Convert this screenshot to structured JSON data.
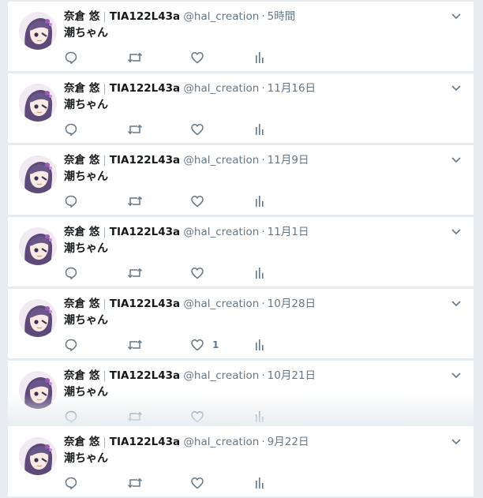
{
  "tweets": [
    {
      "name": "奈倉 悠",
      "display": "TIA122L43a",
      "handle": "@hal_creation",
      "time": "5時間",
      "text": "潮ちゃん",
      "likes": ""
    },
    {
      "name": "奈倉 悠",
      "display": "TIA122L43a",
      "handle": "@hal_creation",
      "time": "11月16日",
      "text": "潮ちゃん",
      "likes": ""
    },
    {
      "name": "奈倉 悠",
      "display": "TIA122L43a",
      "handle": "@hal_creation",
      "time": "11月9日",
      "text": "潮ちゃん",
      "likes": ""
    },
    {
      "name": "奈倉 悠",
      "display": "TIA122L43a",
      "handle": "@hal_creation",
      "time": "11月1日",
      "text": "潮ちゃん",
      "likes": ""
    },
    {
      "name": "奈倉 悠",
      "display": "TIA122L43a",
      "handle": "@hal_creation",
      "time": "10月28日",
      "text": "潮ちゃん",
      "likes": "1"
    },
    {
      "name": "奈倉 悠",
      "display": "TIA122L43a",
      "handle": "@hal_creation",
      "time": "10月21日",
      "text": "潮ちゃん",
      "likes": ""
    },
    {
      "name": "奈倉 悠",
      "display": "TIA122L43a",
      "handle": "@hal_creation",
      "time": "9月22日",
      "text": "潮ちゃん",
      "likes": ""
    }
  ],
  "icons": {
    "reply": "reply-icon",
    "retweet": "retweet-icon",
    "like": "heart-icon",
    "stats": "analytics-icon",
    "more": "chevron-down-icon",
    "avatar": "avatar"
  },
  "colors": {
    "icon": "#657786",
    "background": "#e6ecf0",
    "card": "#ffffff",
    "text": "#14171a"
  }
}
